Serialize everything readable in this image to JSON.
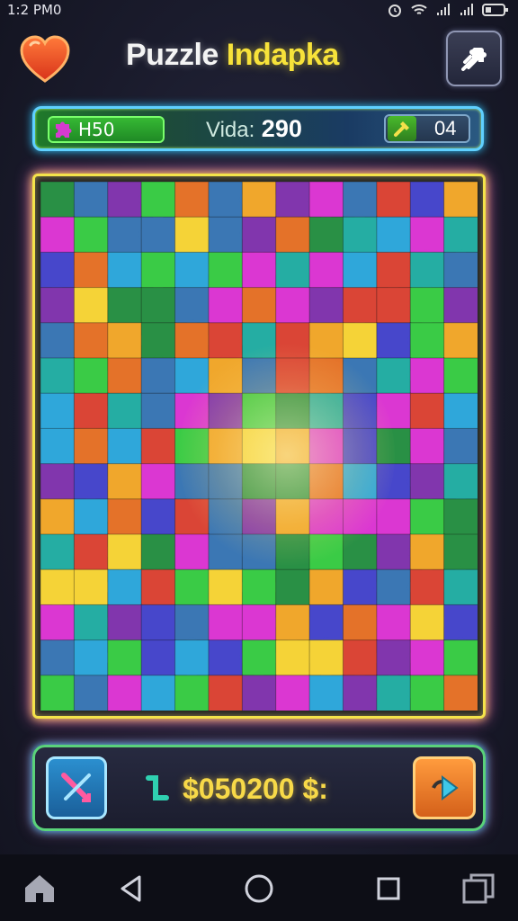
{
  "status": {
    "time": "1:2 PM0"
  },
  "header": {
    "title_part1": "Puzzle",
    "title_part2": "Indapka"
  },
  "stats": {
    "left_label": "H50",
    "score_label": "Vida:",
    "score_value": "290",
    "right_value": "04"
  },
  "board": {
    "rows": 15,
    "cols": 13,
    "palette": [
      "#7a2aa8",
      "#d92bd0",
      "#2f6fb0",
      "#23a2d8",
      "#2ec83b",
      "#1c8a3a",
      "#f0a21f",
      "#e36a1c",
      "#d83a2a",
      "#f5d12b",
      "#18a89e",
      "#3c3cc8"
    ]
  },
  "footer": {
    "coins_text": "$050200 $:"
  },
  "colors": {
    "accent_yellow": "#f7e23a",
    "accent_cyan": "#5fd0ff",
    "accent_green": "#5ad27a"
  },
  "icons": {
    "heart": "heart-icon",
    "settings": "puzzle-settings-icon",
    "tool": "pencil-wand-icon",
    "next": "arrow-right-icon",
    "coin": "snake-coin-icon"
  }
}
